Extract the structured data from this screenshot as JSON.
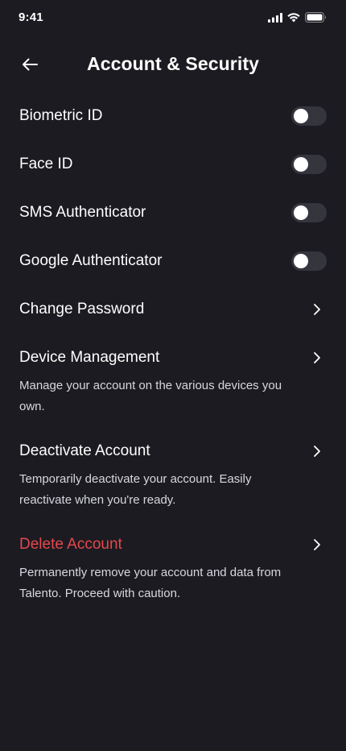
{
  "status_bar": {
    "time": "9:41"
  },
  "header": {
    "title": "Account & Security",
    "back_icon": "arrow-left-icon"
  },
  "toggles": [
    {
      "label": "Biometric ID",
      "on": false
    },
    {
      "label": "Face ID",
      "on": false
    },
    {
      "label": "SMS Authenticator",
      "on": false
    },
    {
      "label": "Google Authenticator",
      "on": false
    }
  ],
  "links": {
    "change_password": {
      "label": "Change Password"
    },
    "device_management": {
      "label": "Device Management",
      "description": "Manage your account on the various devices you own."
    },
    "deactivate_account": {
      "label": "Deactivate Account",
      "description": "Temporarily deactivate your account. Easily reactivate when you're ready."
    },
    "delete_account": {
      "label": "Delete Account",
      "description": "Permanently remove your account and data from Talento. Proceed with caution."
    }
  },
  "colors": {
    "background": "#1b1b21",
    "toggle_track": "#35353d",
    "danger": "#e5484d"
  }
}
